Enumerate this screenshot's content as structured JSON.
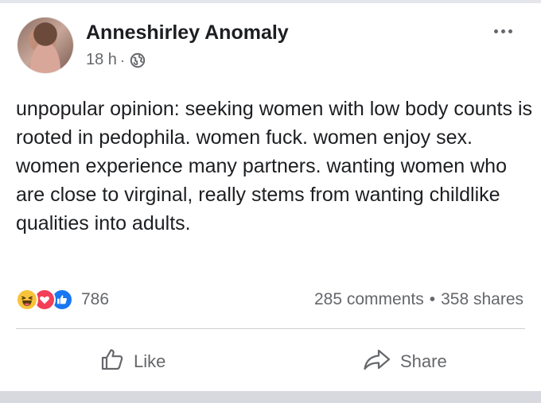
{
  "post": {
    "author": "Anneshirley Anomaly",
    "time": "18 h",
    "separator": "·",
    "privacy_icon": "globe-icon",
    "text": "unpopular opinion: seeking women with low body counts is rooted in pedophila. women fuck. women enjoy sex. women experience many partners. wanting women who are close to virginal, really stems from wanting childlike qualities into adults."
  },
  "engagement": {
    "reaction_icons": [
      "haha-icon",
      "love-icon",
      "like-icon"
    ],
    "reaction_count": "786",
    "comments": "285 comments",
    "dot": "•",
    "shares": "358 shares"
  },
  "actions": {
    "like_label": "Like",
    "share_label": "Share"
  },
  "colors": {
    "text": "#1c1e21",
    "secondary": "#65676b",
    "like_blue": "#1877f2",
    "love_red": "#f33e58",
    "haha_yellow": "#f7c33a"
  }
}
